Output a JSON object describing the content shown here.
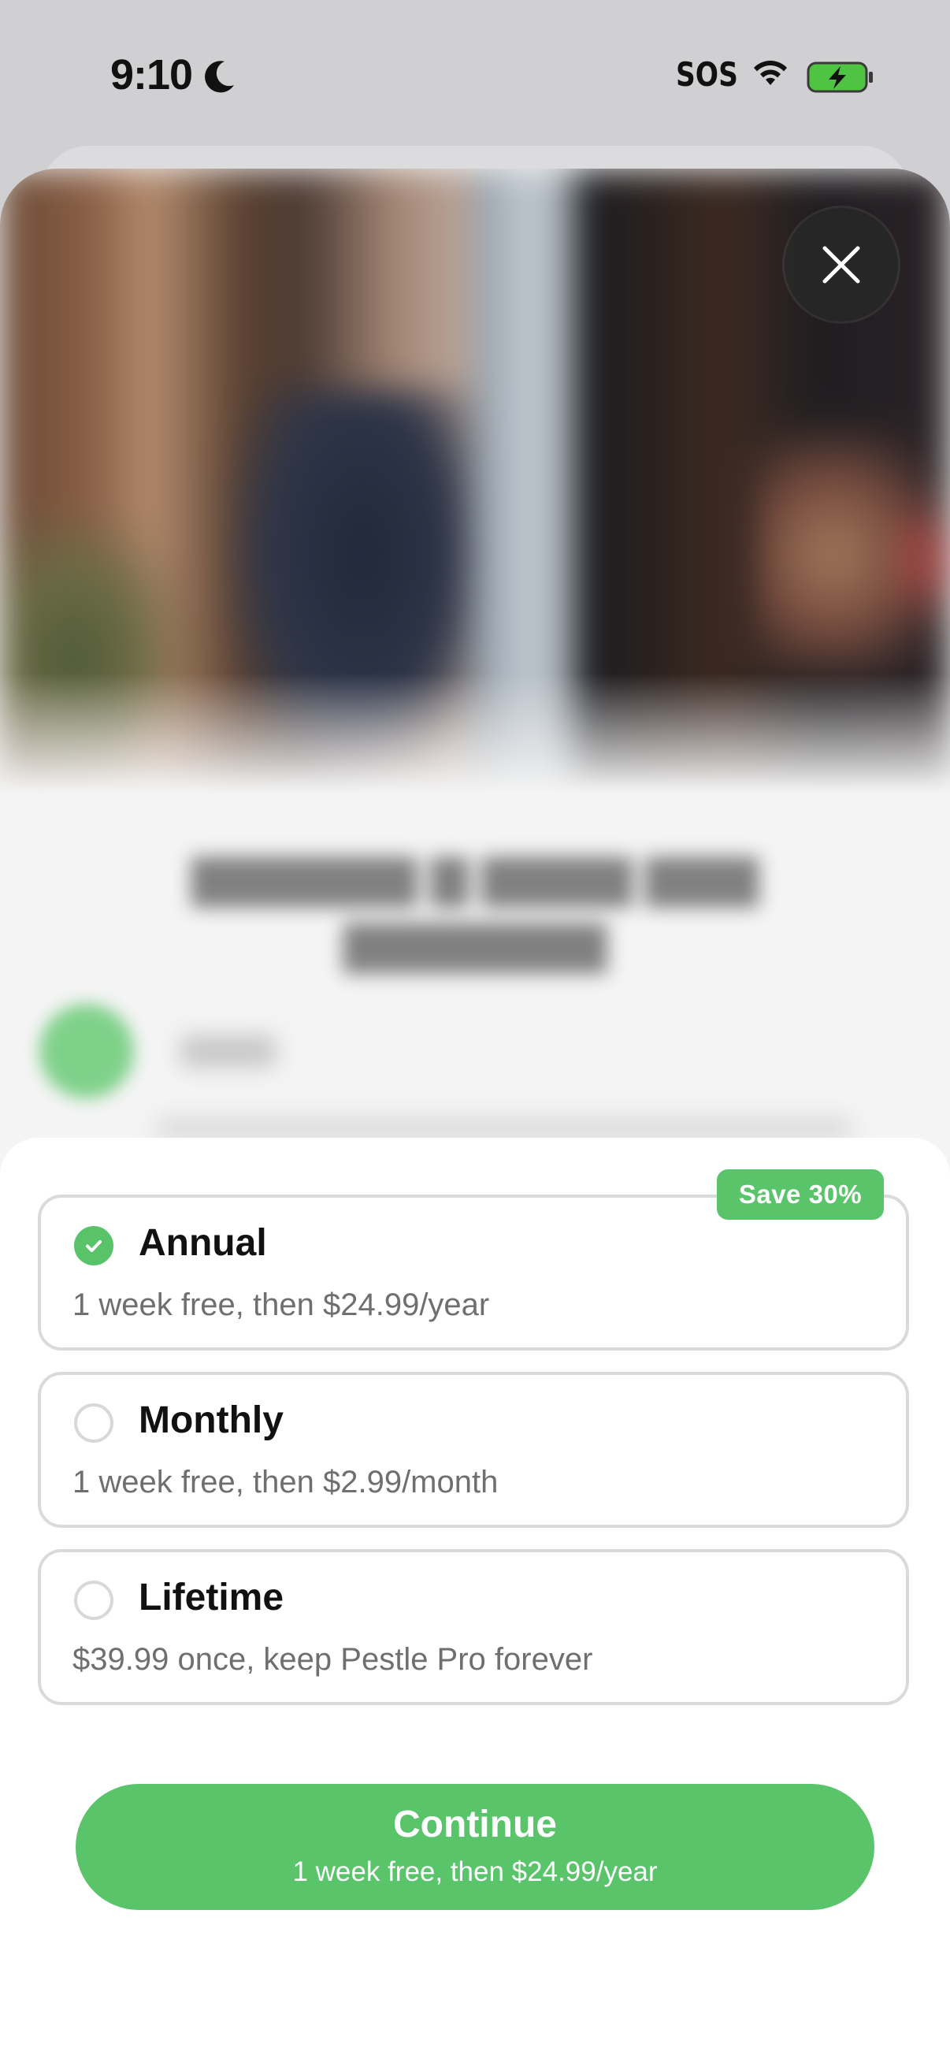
{
  "status_bar": {
    "time": "9:10",
    "carrier": "SOS",
    "icons": [
      "moon-icon",
      "wifi-icon",
      "battery-charging-icon"
    ]
  },
  "header": {
    "close_icon": "close-icon"
  },
  "plans": [
    {
      "name": "Annual",
      "description": "1 week free, then $24.99/year",
      "selected": true,
      "badge": "Save 30%"
    },
    {
      "name": "Monthly",
      "description": "1 week free, then $2.99/month",
      "selected": false
    },
    {
      "name": "Lifetime",
      "description": "$39.99 once, keep Pestle Pro forever",
      "selected": false
    }
  ],
  "cta": {
    "label": "Continue",
    "sublabel": "1 week free, then $24.99/year"
  },
  "colors": {
    "accent": "#5AC46B",
    "background": "#FFFFFF",
    "text_primary": "#111111",
    "text_secondary": "#6F6F6F"
  }
}
